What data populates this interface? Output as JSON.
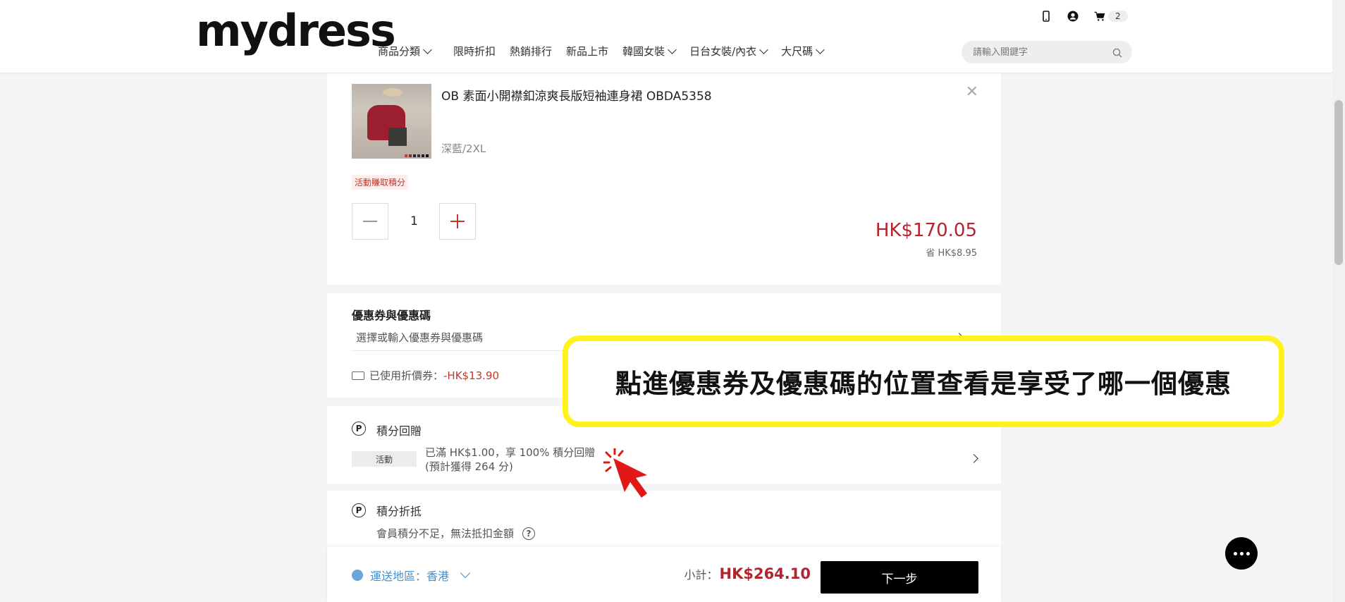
{
  "header": {
    "logo": "mydress",
    "nav": [
      {
        "label": "商品分類",
        "dropdown": true
      },
      {
        "label": "限時折扣",
        "dropdown": false
      },
      {
        "label": "熱銷排行",
        "dropdown": false
      },
      {
        "label": "新品上市",
        "dropdown": false
      },
      {
        "label": "韓國女裝",
        "dropdown": true
      },
      {
        "label": "日台女裝/內衣",
        "dropdown": true
      },
      {
        "label": "大尺碼",
        "dropdown": true
      }
    ],
    "cart_count": "2",
    "search_placeholder": "請輸入關鍵字"
  },
  "product": {
    "name": "OB 素面小開襟釦涼爽長版短袖連身裙 OBDA5358",
    "variant": "深藍/2XL",
    "promo_tag": "活動賺取積分",
    "quantity": "1",
    "price": "HK$170.05",
    "save": "省 HK$8.95"
  },
  "coupon": {
    "title": "優惠券與優惠碼",
    "select_label": "選擇或輸入優惠券與優惠碼",
    "used_label": "已使用折價券：",
    "used_amount": "-HK$13.90"
  },
  "points_reward": {
    "icon_letter": "P",
    "title": "積分回贈",
    "tag": "活動",
    "line1": "已滿 HK$1.00，享 100% 積分回贈",
    "line2": "(預計獲得 264 分)"
  },
  "points_redeem": {
    "icon_letter": "P",
    "title": "積分折抵",
    "text": "會員積分不足，無法抵扣金額",
    "help": "?"
  },
  "footer": {
    "region": "運送地區：香港",
    "subtotal_label": "小計：",
    "subtotal_amount": "HK$264.10",
    "next_label": "下一步"
  },
  "annotation": {
    "text": "點進優惠券及優惠碼的位置查看是享受了哪一個優惠"
  },
  "colors": {
    "price_red": "#b3252e",
    "highlight_yellow": "#fff21e",
    "link_blue": "#4a8fc9"
  }
}
